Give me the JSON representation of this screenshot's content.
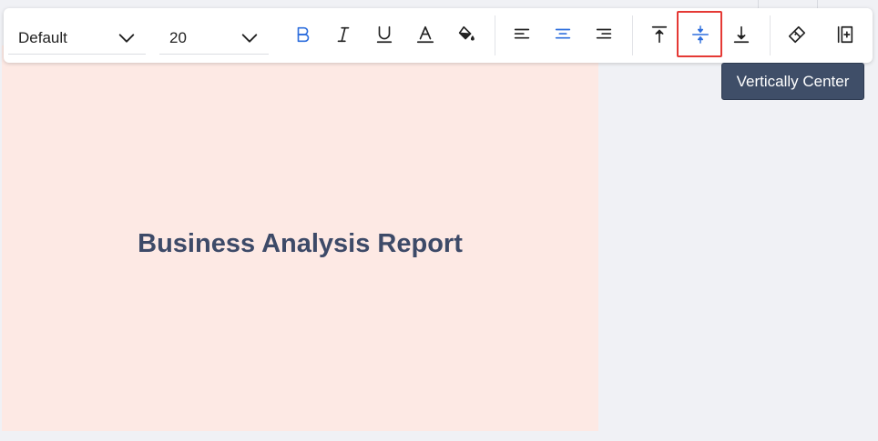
{
  "toolbar": {
    "font_family": {
      "value": "Default"
    },
    "font_size": {
      "value": "20"
    },
    "buttons": {
      "bold": {
        "icon": "bold-icon",
        "active": true
      },
      "italic": {
        "icon": "italic-icon"
      },
      "underline": {
        "icon": "underline-icon"
      },
      "font_color": {
        "icon": "font-color-icon"
      },
      "fill_color": {
        "icon": "paint-bucket-icon"
      },
      "align_left": {
        "icon": "align-left-icon"
      },
      "align_center": {
        "icon": "align-center-icon",
        "active": true
      },
      "align_right": {
        "icon": "align-right-icon"
      },
      "valign_top": {
        "icon": "vertical-align-top-icon"
      },
      "valign_middle": {
        "icon": "vertical-align-middle-icon",
        "active": true,
        "highlighted": true
      },
      "valign_bottom": {
        "icon": "vertical-align-bottom-icon"
      },
      "clear_format": {
        "icon": "eraser-icon"
      },
      "insert_column": {
        "icon": "insert-column-icon"
      }
    },
    "tooltip": "Vertically Center"
  },
  "cell": {
    "text": "Business Analysis Report"
  },
  "colors": {
    "accent": "#2f6fdd",
    "cell_background": "#fde9e4",
    "cell_text": "#3d4a68",
    "tooltip_background": "#3f4e68",
    "highlight": "#e53935"
  }
}
